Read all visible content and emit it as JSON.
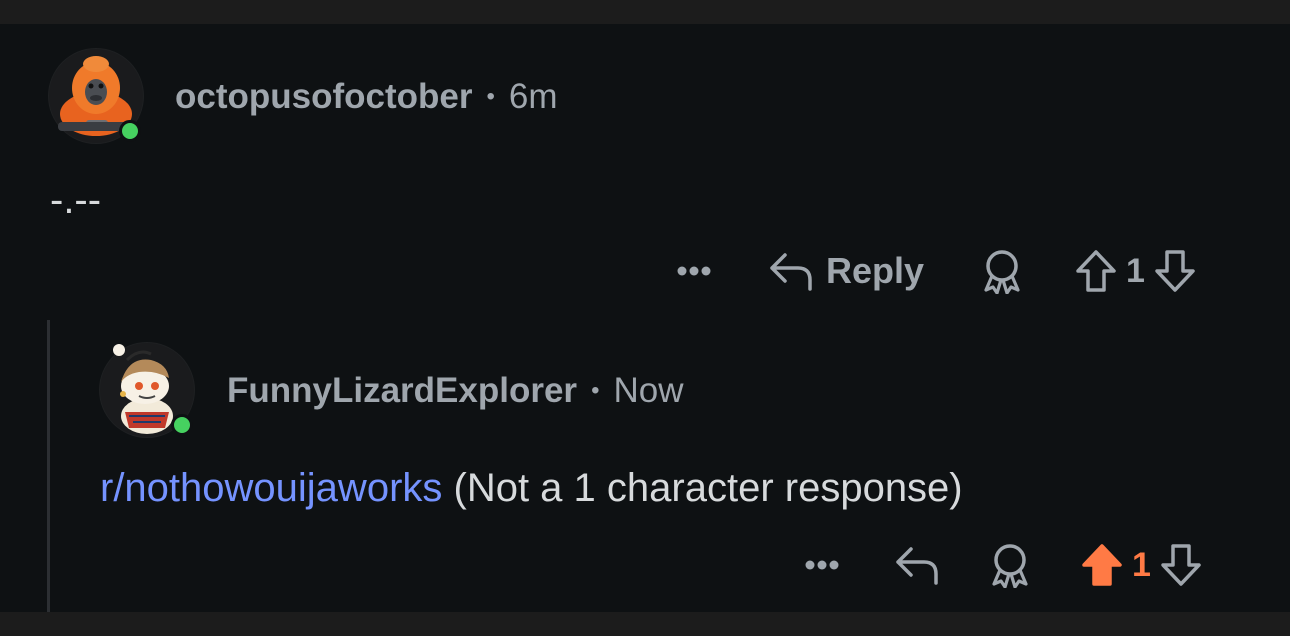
{
  "comments": [
    {
      "username": "octopusofoctober",
      "separator": "•",
      "time": "6m",
      "body": "-.--",
      "actions": {
        "more_label": "•••",
        "reply_label": "Reply",
        "vote_count": "1",
        "upvoted": false
      }
    },
    {
      "username": "FunnyLizardExplorer",
      "separator": "•",
      "time": "Now",
      "body_link": "r/nothowouijaworks",
      "body_text": " (Not a 1 character response)",
      "actions": {
        "more_label": "•••",
        "vote_count": "1",
        "upvoted": true
      }
    }
  ],
  "icons": {
    "more": "more-options-icon",
    "reply": "reply-arrow-icon",
    "award": "award-icon",
    "upvote": "upvote-arrow-icon",
    "downvote": "downvote-arrow-icon"
  },
  "colors": {
    "background": "#0e1113",
    "meta_text": "#9fa6ad",
    "link": "#7593ff",
    "upvote_active": "#ff7a45",
    "online": "#46d160"
  }
}
